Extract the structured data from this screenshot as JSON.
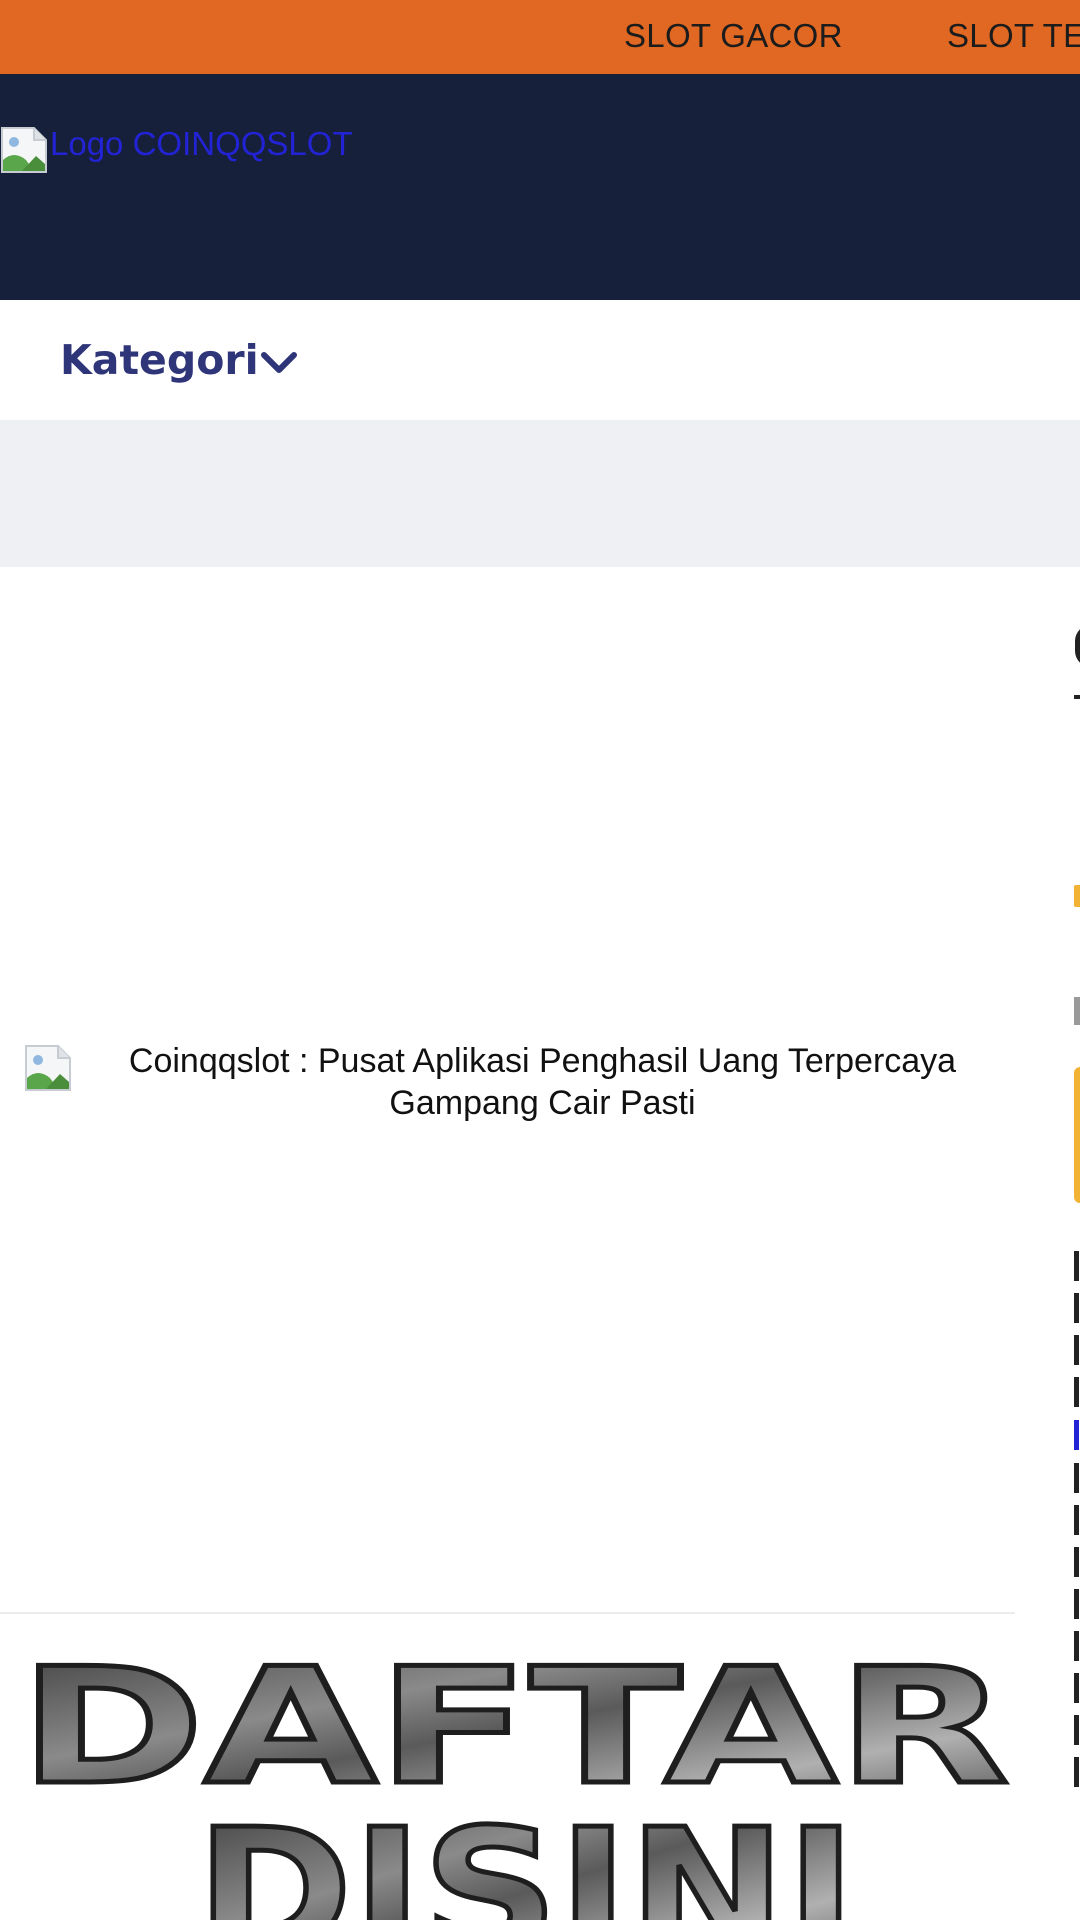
{
  "topnav": {
    "items": [
      "SLOT GACOR",
      "SLOT TE"
    ]
  },
  "header": {
    "logo_alt": "Logo COINQQSLOT"
  },
  "category": {
    "label": "Kategori"
  },
  "hero": {
    "alt_text": "Coinqqslot : Pusat Aplikasi Penghasil Uang Terpercaya Gampang Cair Pasti"
  },
  "banner": {
    "line1": "DAFTAR",
    "line2": "DISINI"
  },
  "colors": {
    "topbar": "#e06822",
    "header": "#16203a",
    "category_text": "#2f3579",
    "gray_band": "#eff0f4",
    "link_blue": "#2323d6",
    "accent_yellow": "#f2b233"
  }
}
